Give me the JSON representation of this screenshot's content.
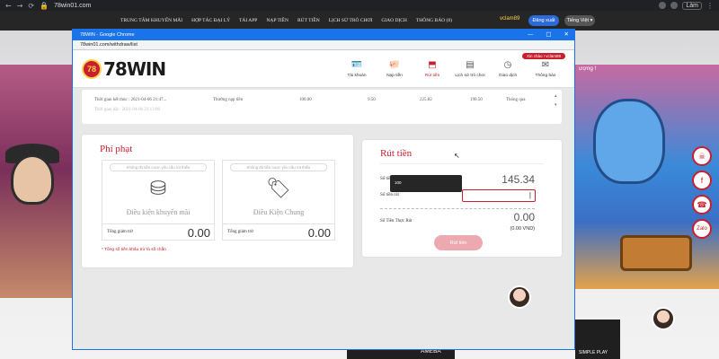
{
  "outer_browser": {
    "back": "←",
    "forward": "→",
    "reload": "⟳",
    "url": "78win01.com",
    "reload_btn": "Làm"
  },
  "site_header": {
    "menu": [
      "TRUNG TÂM KHUYẾN MÃI",
      "HỢP TÁC ĐẠI LÝ",
      "TẢI APP",
      "NẠP TIỀN",
      "RÚT TIỀN",
      "LỊCH SỬ TRÒ CHƠI",
      "GIAO DỊCH",
      "THÔNG BÁO (8)"
    ],
    "username": "vclam89",
    "logout": "Đăng xuất",
    "language": "Tiếng Việt ▾"
  },
  "background": {
    "right_banner_text": "ượng !",
    "bottom_tags": [
      "AMEBA",
      "SIMPLE PLAY"
    ]
  },
  "popup": {
    "window_title": "78WIN - Google Chrome",
    "window_buttons": [
      "—",
      "□",
      "✕"
    ],
    "url": "78win01.com/withdraw/list",
    "welcome": "Xin chào ! vclam89",
    "logo_badge": "78",
    "logo_text": "78WIN",
    "nav": [
      {
        "label": "Tài khoản",
        "icon": "🪪",
        "active": false
      },
      {
        "label": "Nạp tiền",
        "icon": "🐖",
        "active": false
      },
      {
        "label": "Rút tiền",
        "icon": "⬒",
        "active": true
      },
      {
        "label": "Lịch sử trò chơi",
        "icon": "▤",
        "active": false
      },
      {
        "label": "Giao dịch",
        "icon": "◷",
        "active": false
      },
      {
        "label": "Thông báo",
        "icon": "✉",
        "active": false
      }
    ]
  },
  "history": {
    "row1": {
      "time": "Thời gian kết thúc : 2021-04-06 21:47...",
      "type": "Thưởng nạp tiền",
      "amount": "100.00",
      "bonus": "9.50",
      "wager": "225.82",
      "wager2": "190.50",
      "status": "Thông qua"
    },
    "row2": {
      "time": "Thời gian bắt : 2021-04-06 21:13:00"
    },
    "scroll_up": "▴",
    "scroll_down": "▾"
  },
  "penalty": {
    "title": "Phí phạt",
    "boxes": [
      {
        "note": "Không đủ tiền cược yêu cầu rút thiếu",
        "icon": "⛁",
        "label": "Điều kiện khuyến mãi",
        "total_label": "Tổng giảm trừ",
        "total_value": "0.00"
      },
      {
        "note": "Không đủ tiền cược yêu cầu rút thiếu",
        "icon": "🏷",
        "label": "Điều Kiện Chung",
        "total_label": "Tổng giảm trừ",
        "total_value": "0.00"
      }
    ],
    "footnote": "* Tổng số tiền khấu trừ là số chẵn"
  },
  "withdraw": {
    "title": "Rút tiền",
    "available_label": "Số tiền có thể rút",
    "available_value": "145.34",
    "amount_label": "Số tiền rút",
    "amount_value": "",
    "real_label": "Số Tiền Thực Rút",
    "real_value": "0.00",
    "vnd": "(0.00 VND)",
    "button": "Rút tiền",
    "autocomplete_option": "100"
  }
}
